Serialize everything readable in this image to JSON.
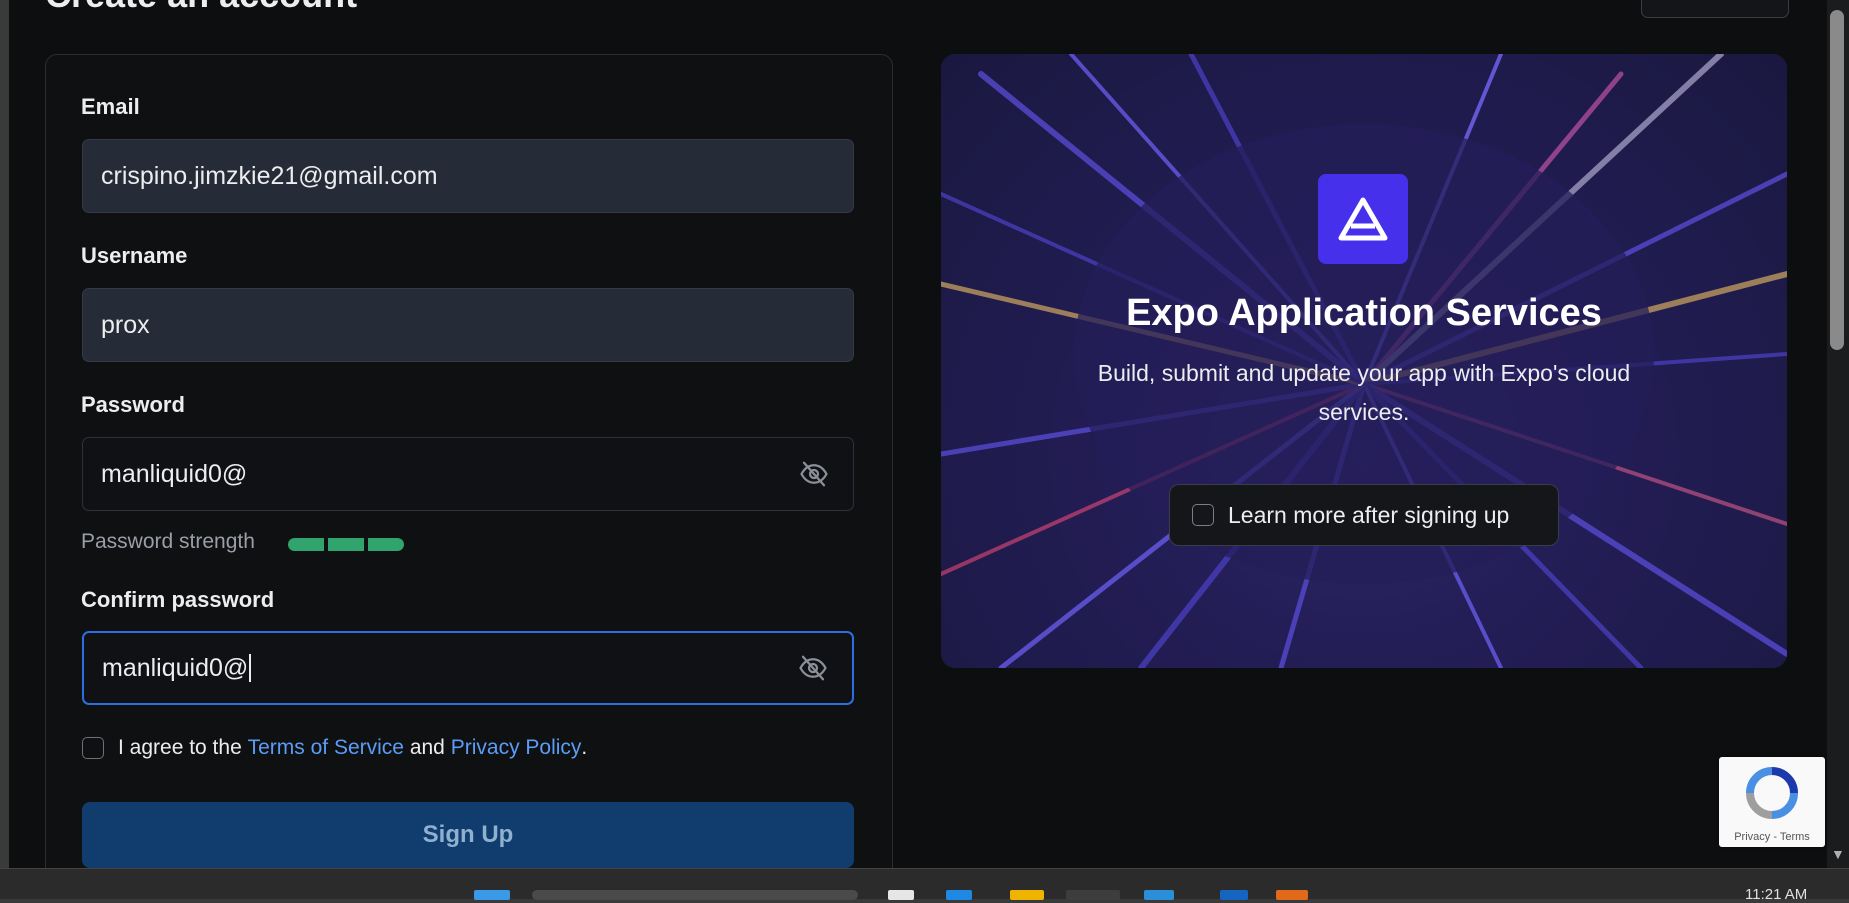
{
  "header": {
    "title": "Create an account"
  },
  "form": {
    "email": {
      "label": "Email",
      "value": "crispino.jimzkie21@gmail.com"
    },
    "username": {
      "label": "Username",
      "value": "prox"
    },
    "password": {
      "label": "Password",
      "value": "manliquid0@"
    },
    "strength": {
      "label": "Password strength",
      "level": 1.0,
      "color": "#30a46c"
    },
    "confirm": {
      "label": "Confirm password",
      "value": "manliquid0@"
    },
    "agree": {
      "prefix": "I agree to the",
      "terms": "Terms of Service",
      "and": "and",
      "privacy": "Privacy Policy",
      "suffix": "."
    },
    "submit": "Sign Up"
  },
  "promo": {
    "title": "Expo Application Services",
    "subtitle": "Build, submit and update your app with Expo's cloud services.",
    "checkbox_label": "Learn more after signing up",
    "logo_icon": "expo-triangle-icon",
    "accent": "#4630eb"
  },
  "recaptcha": {
    "links": "Privacy - Terms"
  },
  "taskbar": {
    "clock": "11:21 AM"
  }
}
